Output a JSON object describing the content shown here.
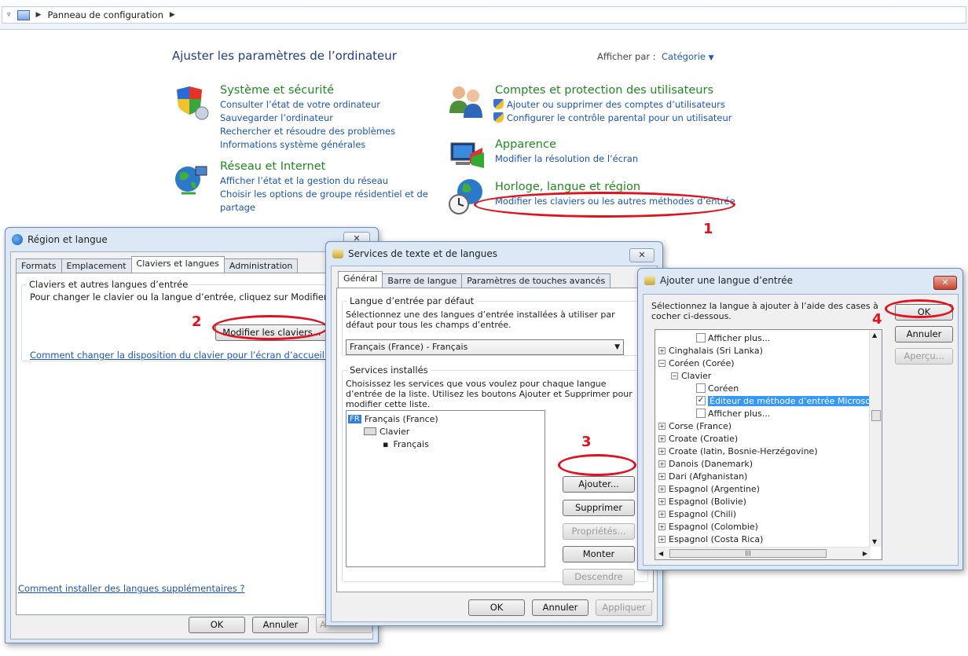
{
  "address": {
    "crumb": "Panneau de configuration"
  },
  "cp": {
    "title": "Ajuster les paramètres de l’ordinateur",
    "view_label": "Afficher par :",
    "view_value": "Catégorie",
    "left": [
      {
        "title": "Système et sécurité",
        "links": [
          "Consulter l’état de votre ordinateur",
          "Sauvegarder l’ordinateur",
          "Rechercher et résoudre des problèmes",
          "Informations système générales"
        ]
      },
      {
        "title": "Réseau et Internet",
        "links": [
          "Afficher l’état et la gestion du réseau",
          "Choisir les options de groupe résidentiel et de",
          "partage"
        ]
      }
    ],
    "right": [
      {
        "title": "Comptes et protection des utilisateurs",
        "links": [
          "Ajouter ou supprimer des comptes d’utilisateurs",
          "Configurer le contrôle parental pour un utilisateur"
        ]
      },
      {
        "title": "Apparence",
        "links": [
          "Modifier la résolution de l’écran"
        ]
      },
      {
        "title": "Horloge, langue et région",
        "links": [
          "Modifier les claviers ou les autres méthodes d’entrée"
        ]
      }
    ]
  },
  "steps": [
    "1",
    "2",
    "3",
    "4"
  ],
  "region": {
    "title": "Région et langue",
    "tabs": [
      "Formats",
      "Emplacement",
      "Claviers et langues",
      "Administration"
    ],
    "group": "Claviers et autres langues d’entrée",
    "desc": "Pour changer le clavier ou la langue d’entrée, cliquez sur Modifier les cl",
    "modify": "Modifier les claviers...",
    "link1": "Comment changer la disposition du clavier pour l’écran d’accueil ?",
    "link2": "Comment installer des langues supplémentaires ?",
    "ok": "OK",
    "cancel": "Annuler",
    "apply": "A"
  },
  "services": {
    "title": "Services de texte et de langues",
    "tabs": [
      "Général",
      "Barre de langue",
      "Paramètres de touches avancés"
    ],
    "g1": "Langue d’entrée par défaut",
    "g1_desc": "Sélectionnez une des langues d’entrée installées à utiliser par défaut pour tous les champs d’entrée.",
    "combo": "Français (France) - Français",
    "g2": "Services installés",
    "g2_desc": "Choisissez les services que vous voulez pour chaque langue d’entrée de la liste. Utilisez les boutons Ajouter et Supprimer pour modifier cette liste.",
    "tree": {
      "lang_badge": "FR",
      "lang": "Français (France)",
      "kb": "Clavier",
      "layout": "Français"
    },
    "add": "Ajouter...",
    "remove": "Supprimer",
    "props": "Propriétés...",
    "up": "Monter",
    "down": "Descendre",
    "ok": "OK",
    "cancel": "Annuler",
    "apply": "Appliquer"
  },
  "addlang": {
    "title": "Ajouter une langue d’entrée",
    "desc": "Sélectionnez la langue à ajouter à l’aide des cases à cocher ci-dessous.",
    "ok": "OK",
    "cancel": "Annuler",
    "preview": "Aperçu...",
    "items": [
      {
        "t": "Afficher plus...",
        "lvl": 3,
        "cb": true
      },
      {
        "t": "Cinghalais (Sri Lanka)",
        "lvl": 0,
        "pm": "+"
      },
      {
        "t": "Coréen (Corée)",
        "lvl": 0,
        "pm": "−"
      },
      {
        "t": "Clavier",
        "lvl": 1,
        "pm": "−"
      },
      {
        "t": "Coréen",
        "lvl": 3,
        "cb": true
      },
      {
        "t": "Éditeur de méthode d’entrée Microsoft",
        "lvl": 3,
        "cb": true,
        "checked": true,
        "sel": true
      },
      {
        "t": "Afficher plus...",
        "lvl": 3,
        "cb": true
      },
      {
        "t": "Corse (France)",
        "lvl": 0,
        "pm": "+"
      },
      {
        "t": "Croate (Croatie)",
        "lvl": 0,
        "pm": "+"
      },
      {
        "t": "Croate (latin, Bosnie-Herzégovine)",
        "lvl": 0,
        "pm": "+"
      },
      {
        "t": "Danois (Danemark)",
        "lvl": 0,
        "pm": "+"
      },
      {
        "t": "Dari (Afghanistan)",
        "lvl": 0,
        "pm": "+"
      },
      {
        "t": "Espagnol (Argentine)",
        "lvl": 0,
        "pm": "+"
      },
      {
        "t": "Espagnol (Bolivie)",
        "lvl": 0,
        "pm": "+"
      },
      {
        "t": "Espagnol (Chili)",
        "lvl": 0,
        "pm": "+"
      },
      {
        "t": "Espagnol (Colombie)",
        "lvl": 0,
        "pm": "+"
      },
      {
        "t": "Espagnol (Costa Rica)",
        "lvl": 0,
        "pm": "+"
      }
    ]
  },
  "colors": {
    "accent_red": "#e0121f",
    "link": "#1a55b8",
    "category": "#1f8a1f"
  }
}
